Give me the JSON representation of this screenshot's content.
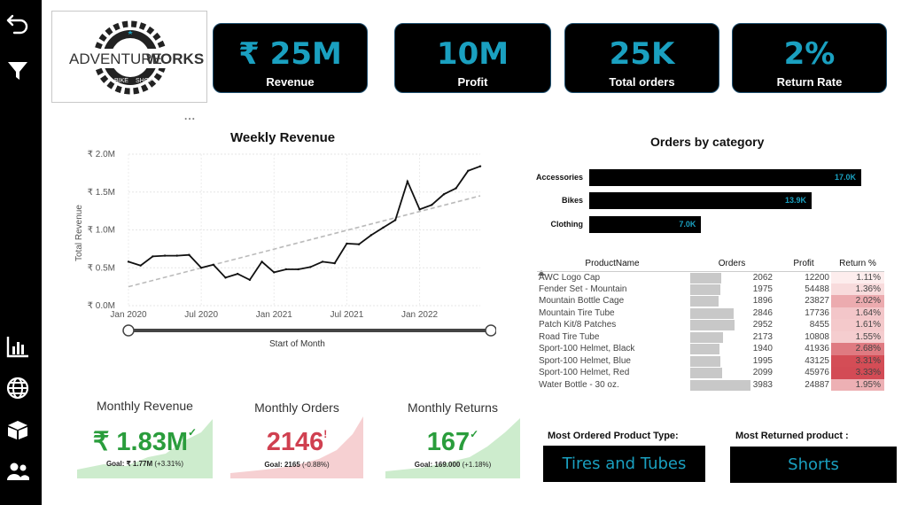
{
  "logo": {
    "text_left": "ADVENTURE",
    "text_right": "WORKS",
    "arc_left": "BIKE",
    "arc_right": "SHOP"
  },
  "kpis": [
    {
      "value": "₹ 25M",
      "label": "Revenue"
    },
    {
      "value": "10M",
      "label": "Profit"
    },
    {
      "value": "25K",
      "label": "Total orders"
    },
    {
      "value": "2%",
      "label": "Return Rate"
    }
  ],
  "weekly_chart": {
    "title": "Weekly Revenue",
    "ylabel": "Total Revenue",
    "xlabel": "Start of Month",
    "more_dots": "...",
    "y_ticks": [
      "₹ 2.0M",
      "₹ 1.5M",
      "₹ 1.0M",
      "₹ 0.5M",
      "₹ 0.0M"
    ],
    "x_ticks": [
      "Jan 2020",
      "Jul 2020",
      "Jan 2021",
      "Jul 2021",
      "Jan 2022"
    ]
  },
  "chart_data": [
    {
      "type": "line",
      "title": "Weekly Revenue",
      "xlabel": "Start of Month",
      "ylabel": "Total Revenue",
      "ylim": [
        0,
        2.0
      ],
      "y_unit": "₹ M",
      "x": [
        "2020-01",
        "2020-02",
        "2020-03",
        "2020-04",
        "2020-05",
        "2020-06",
        "2020-07",
        "2020-08",
        "2020-09",
        "2020-10",
        "2020-11",
        "2020-12",
        "2021-01",
        "2021-02",
        "2021-03",
        "2021-04",
        "2021-05",
        "2021-06",
        "2021-07",
        "2021-08",
        "2021-09",
        "2021-10",
        "2021-11",
        "2021-12",
        "2022-01",
        "2022-02",
        "2022-03",
        "2022-04",
        "2022-05",
        "2022-06"
      ],
      "series": [
        {
          "values": [
            0.58,
            0.53,
            0.65,
            0.66,
            0.66,
            0.67,
            0.5,
            0.54,
            0.37,
            0.42,
            0.34,
            0.58,
            0.44,
            0.48,
            0.48,
            0.51,
            0.58,
            0.56,
            0.82,
            0.81,
            0.93,
            1.03,
            1.13,
            1.64,
            1.27,
            1.33,
            1.47,
            1.55,
            1.78,
            1.84
          ]
        }
      ],
      "trendline": {
        "style": "dashed",
        "start": 0.25,
        "end": 1.45
      },
      "grid": true
    },
    {
      "type": "bar",
      "title": "Orders by category",
      "orientation": "horizontal",
      "categories": [
        "Accessories",
        "Bikes",
        "Clothing"
      ],
      "values": [
        17.0,
        13.9,
        7.0
      ],
      "labels": [
        "17.0K",
        "13.9K",
        "7.0K"
      ]
    }
  ],
  "category_chart": {
    "title": "Orders by category"
  },
  "product_table": {
    "headers": [
      "ProductName",
      "Orders",
      "Profit",
      "Return %"
    ],
    "rows": [
      {
        "name": "AWC Logo Cap",
        "orders": "2062",
        "orders_num": 2062,
        "profit": "12200",
        "ret": "1.11%",
        "ret_num": 1.11
      },
      {
        "name": "Fender Set - Mountain",
        "orders": "1975",
        "orders_num": 1975,
        "profit": "54488",
        "ret": "1.36%",
        "ret_num": 1.36
      },
      {
        "name": "Mountain Bottle Cage",
        "orders": "1896",
        "orders_num": 1896,
        "profit": "23827",
        "ret": "2.02%",
        "ret_num": 2.02
      },
      {
        "name": "Mountain Tire Tube",
        "orders": "2846",
        "orders_num": 2846,
        "profit": "17736",
        "ret": "1.64%",
        "ret_num": 1.64
      },
      {
        "name": "Patch Kit/8 Patches",
        "orders": "2952",
        "orders_num": 2952,
        "profit": "8455",
        "ret": "1.61%",
        "ret_num": 1.61
      },
      {
        "name": "Road Tire Tube",
        "orders": "2173",
        "orders_num": 2173,
        "profit": "10808",
        "ret": "1.55%",
        "ret_num": 1.55
      },
      {
        "name": "Sport-100 Helmet, Black",
        "orders": "1940",
        "orders_num": 1940,
        "profit": "41936",
        "ret": "2.68%",
        "ret_num": 2.68
      },
      {
        "name": "Sport-100 Helmet, Blue",
        "orders": "1995",
        "orders_num": 1995,
        "profit": "43125",
        "ret": "3.31%",
        "ret_num": 3.31
      },
      {
        "name": "Sport-100 Helmet, Red",
        "orders": "2099",
        "orders_num": 2099,
        "profit": "45976",
        "ret": "3.33%",
        "ret_num": 3.33
      },
      {
        "name": "Water Bottle - 30 oz.",
        "orders": "3983",
        "orders_num": 3983,
        "profit": "24887",
        "ret": "1.95%",
        "ret_num": 1.95
      }
    ]
  },
  "mini_cards": [
    {
      "title": "Monthly Revenue",
      "value": "₹ 1.83M",
      "mark": "✓",
      "goal": "Goal: ₹ 1.77M",
      "delta": " (+3.31%)",
      "status": "good"
    },
    {
      "title": "Monthly Orders",
      "value": "2146",
      "mark": "!",
      "goal": "Goal: 2165",
      "delta": " (-0.88%)",
      "status": "bad"
    },
    {
      "title": "Monthly Returns",
      "value": "167",
      "mark": "✓",
      "goal": "Goal: 169.000",
      "delta": " (+1.18%)",
      "status": "good"
    }
  ],
  "most_ordered": {
    "label": "Most Ordered Product Type:",
    "value": "Tires and Tubes"
  },
  "most_returned": {
    "label": "Most Returned product :",
    "value": "Shorts"
  },
  "colors": {
    "accent": "#1aa0c0",
    "good": "#2a9d3c",
    "bad": "#d04050",
    "good_fill": "#cdeccd",
    "bad_fill": "#f6d0d2"
  },
  "icons": [
    "back-arrow-icon",
    "filter-icon",
    "bar-chart-icon",
    "globe-icon",
    "box-icon",
    "users-icon"
  ]
}
